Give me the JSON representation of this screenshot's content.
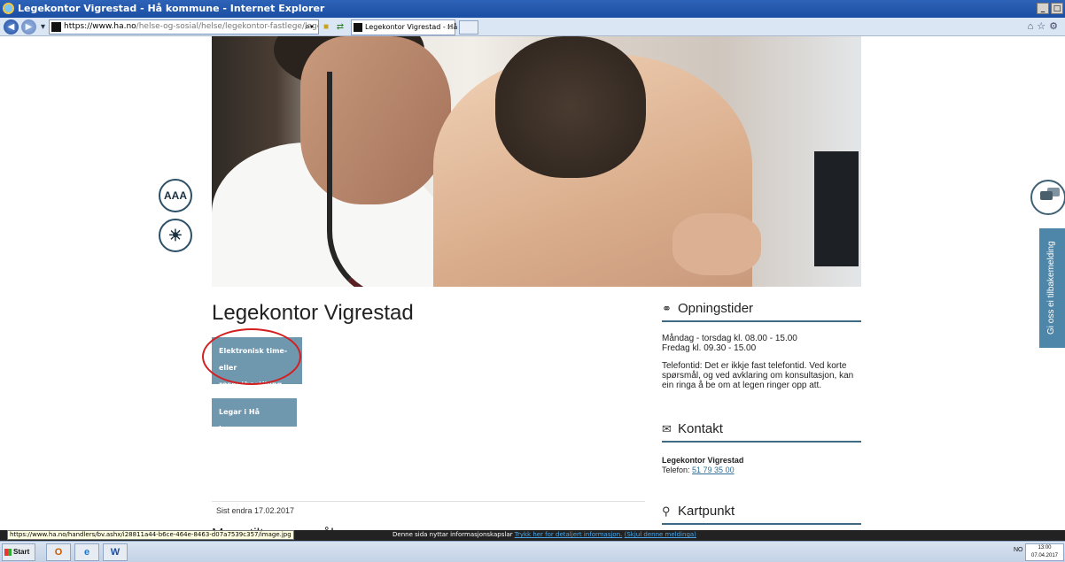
{
  "window": {
    "title": "Legekontor Vigrestad - Hå kommune - Internet Explorer",
    "controls": [
      "_",
      "□",
      "×"
    ]
  },
  "browser": {
    "url_host": "https://www.ha.no",
    "url_path": "/helse-og-sosial/helse/legekontor-fastlege/legekontor-vigrestad/",
    "tab_title": "Legekontor Vigrestad - Hå ko...",
    "tab_close": "×",
    "search_icon": "⌕▾",
    "right_icons": "⌂☆⚙"
  },
  "accessibility": {
    "text_size_label": "AAA",
    "contrast_label": "☀"
  },
  "feedback": {
    "label": "Gi oss ei tilbakemelding"
  },
  "page": {
    "title": "Legekontor Vigrestad",
    "buttons": [
      {
        "label_line1": "Elektronisk time- eller",
        "label_line2": "reseptbestilling"
      },
      {
        "label_line1": "Legar i Hå kommune"
      }
    ],
    "last_edited": "Sist endra 17.02.2017",
    "popular_heading": "Mye stilte spørsmål"
  },
  "sidebar": {
    "opening_hours": {
      "heading": "Opningstider",
      "line1": "Måndag - torsdag kl. 08.00 - 15.00",
      "line2": "Fredag kl. 09.30 - 15.00",
      "phone_note": "Telefontid: Det er ikkje fast telefontid. Ved korte spørsmål, og ved avklaring om konsultasjon, kan ein ringa å be om at legen ringer opp att."
    },
    "contact": {
      "heading": "Kontakt",
      "name": "Legekontor Vigrestad",
      "phone_label": "Telefon: ",
      "phone": "51 79 35 00"
    },
    "map": {
      "heading": "Kartpunkt"
    }
  },
  "statusbar": {
    "url_tip": "https://www.ha.no/handlers/bv.ashx/i28811a44-b6ce-464e-8463-d07a7539c357/image.jpg",
    "cookie_text": "Denne sida nyttar informasjonskapslar ",
    "cookie_link1": "Trykk her for detaljert informasjon.",
    "cookie_link2": "(Skjul denne meldinga)"
  },
  "taskbar": {
    "start_label": "Start",
    "apps": [
      "O",
      "e",
      "W"
    ],
    "lang": "NO",
    "time": "13:00",
    "date": "07.04.2017"
  }
}
